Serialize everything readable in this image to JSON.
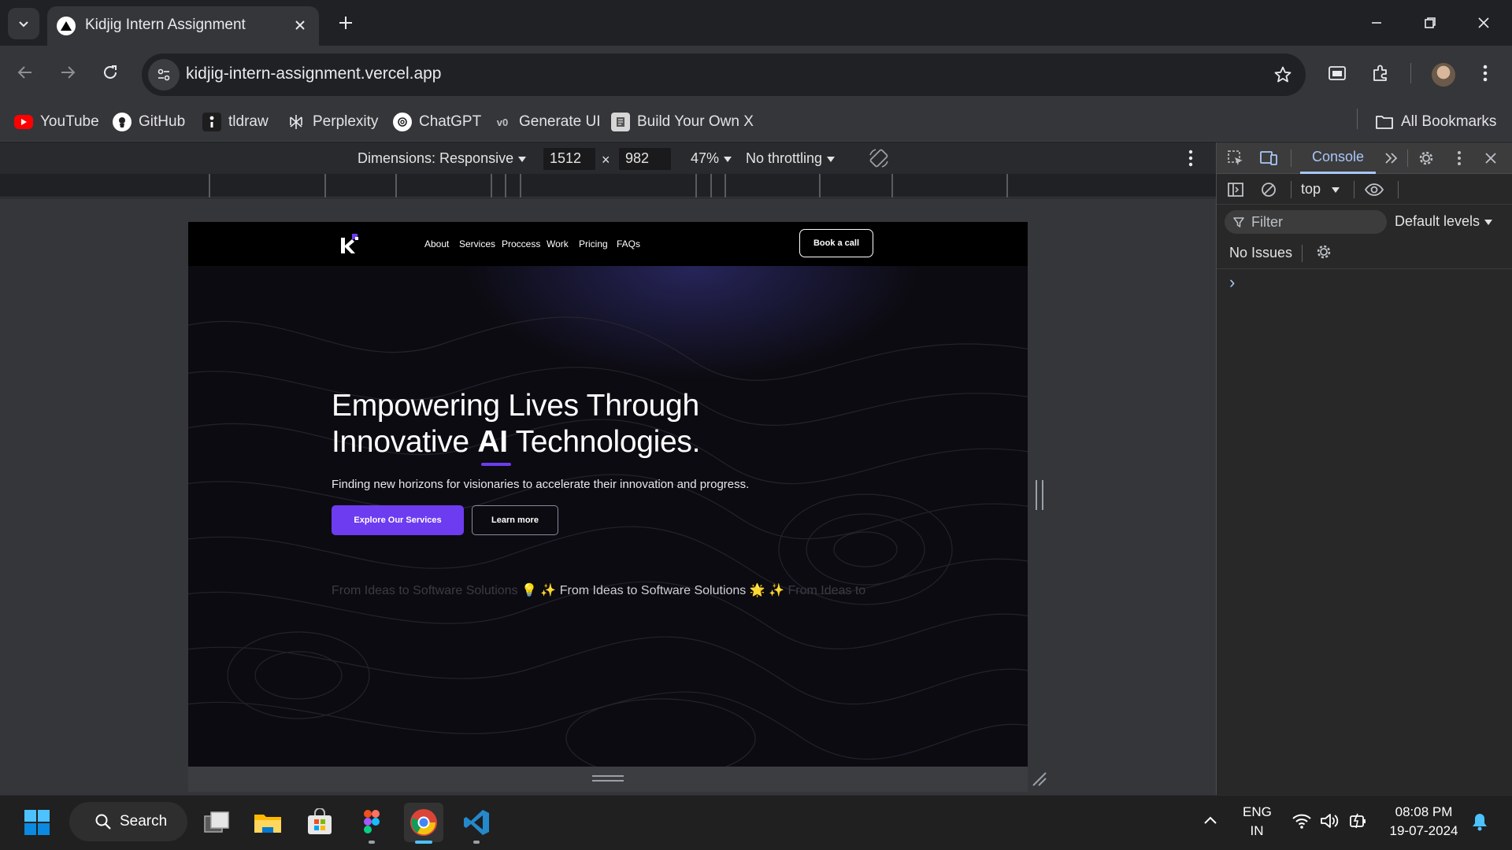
{
  "browser": {
    "tab_title": "Kidjig Intern Assignment",
    "url": "kidjig-intern-assignment.vercel.app",
    "bookmarks": [
      {
        "label": "YouTube",
        "icon": "youtube-icon"
      },
      {
        "label": "GitHub",
        "icon": "github-icon"
      },
      {
        "label": "tldraw",
        "icon": "tldraw-icon"
      },
      {
        "label": "Perplexity",
        "icon": "perplexity-icon"
      },
      {
        "label": "ChatGPT",
        "icon": "chatgpt-icon"
      },
      {
        "label": "Generate UI",
        "icon": "v0-icon"
      },
      {
        "label": "Build Your Own X",
        "icon": "build-your-own-x-icon"
      }
    ],
    "all_bookmarks": "All Bookmarks"
  },
  "device_toolbar": {
    "dimensions_label": "Dimensions: Responsive",
    "width": "1512",
    "times": "×",
    "height": "982",
    "zoom": "47%",
    "throttling": "No throttling"
  },
  "site": {
    "nav": [
      "About",
      "Services",
      "Proccess",
      "Work",
      "Pricing",
      "FAQs"
    ],
    "book_call": "Book a call",
    "hero_line1": "Empowering Lives Through",
    "hero_line2_pre": "Innovative ",
    "hero_line2_ai": "AI",
    "hero_line2_post": " Technologies.",
    "hero_sub": "Finding new horizons for visionaries to accelerate their innovation and progress.",
    "explore": "Explore Our Services",
    "learn": "Learn more",
    "marquee_faded_left": "From Ideas to Software Solutions",
    "marquee_main_1": " 💡 ✨ From Ideas to Software Solutions 🌟 ✨ ",
    "marquee_faded_right": "From Ideas to",
    "accent": "#6d3cf0"
  },
  "devtools": {
    "console_tab": "Console",
    "context": "top",
    "filter_placeholder": "Filter",
    "levels": "Default levels",
    "no_issues": "No Issues",
    "prompt": "›"
  },
  "taskbar": {
    "search": "Search",
    "lang_1": "ENG",
    "lang_2": "IN",
    "time": "08:08 PM",
    "date": "19-07-2024"
  }
}
